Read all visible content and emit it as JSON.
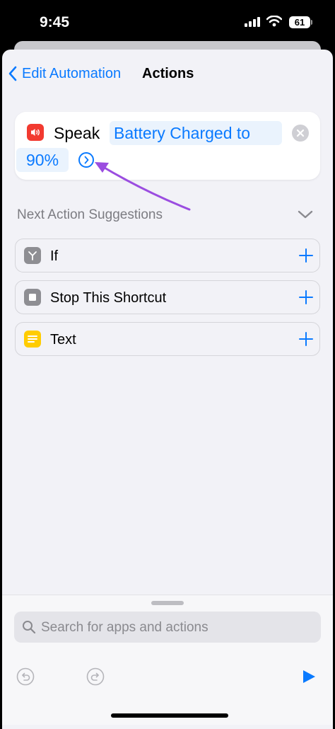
{
  "status_bar": {
    "time": "9:45",
    "battery": "61"
  },
  "nav": {
    "back_label": "Edit Automation",
    "title": "Actions"
  },
  "action_card": {
    "verb": "Speak",
    "token_line1": "Battery Charged to",
    "token_line2": "90%"
  },
  "suggestions": {
    "title": "Next Action Suggestions",
    "items": [
      {
        "label": "If",
        "icon": "if-icon",
        "color": "#8e8e93"
      },
      {
        "label": "Stop This Shortcut",
        "icon": "stop-icon",
        "color": "#8e8e93"
      },
      {
        "label": "Text",
        "icon": "text-icon",
        "color": "#ffcc00"
      }
    ]
  },
  "search": {
    "placeholder": "Search for apps and actions"
  },
  "colors": {
    "accent": "#0a7aff",
    "speak_icon": "#f23a30",
    "annotation_arrow": "#9b4de0"
  }
}
